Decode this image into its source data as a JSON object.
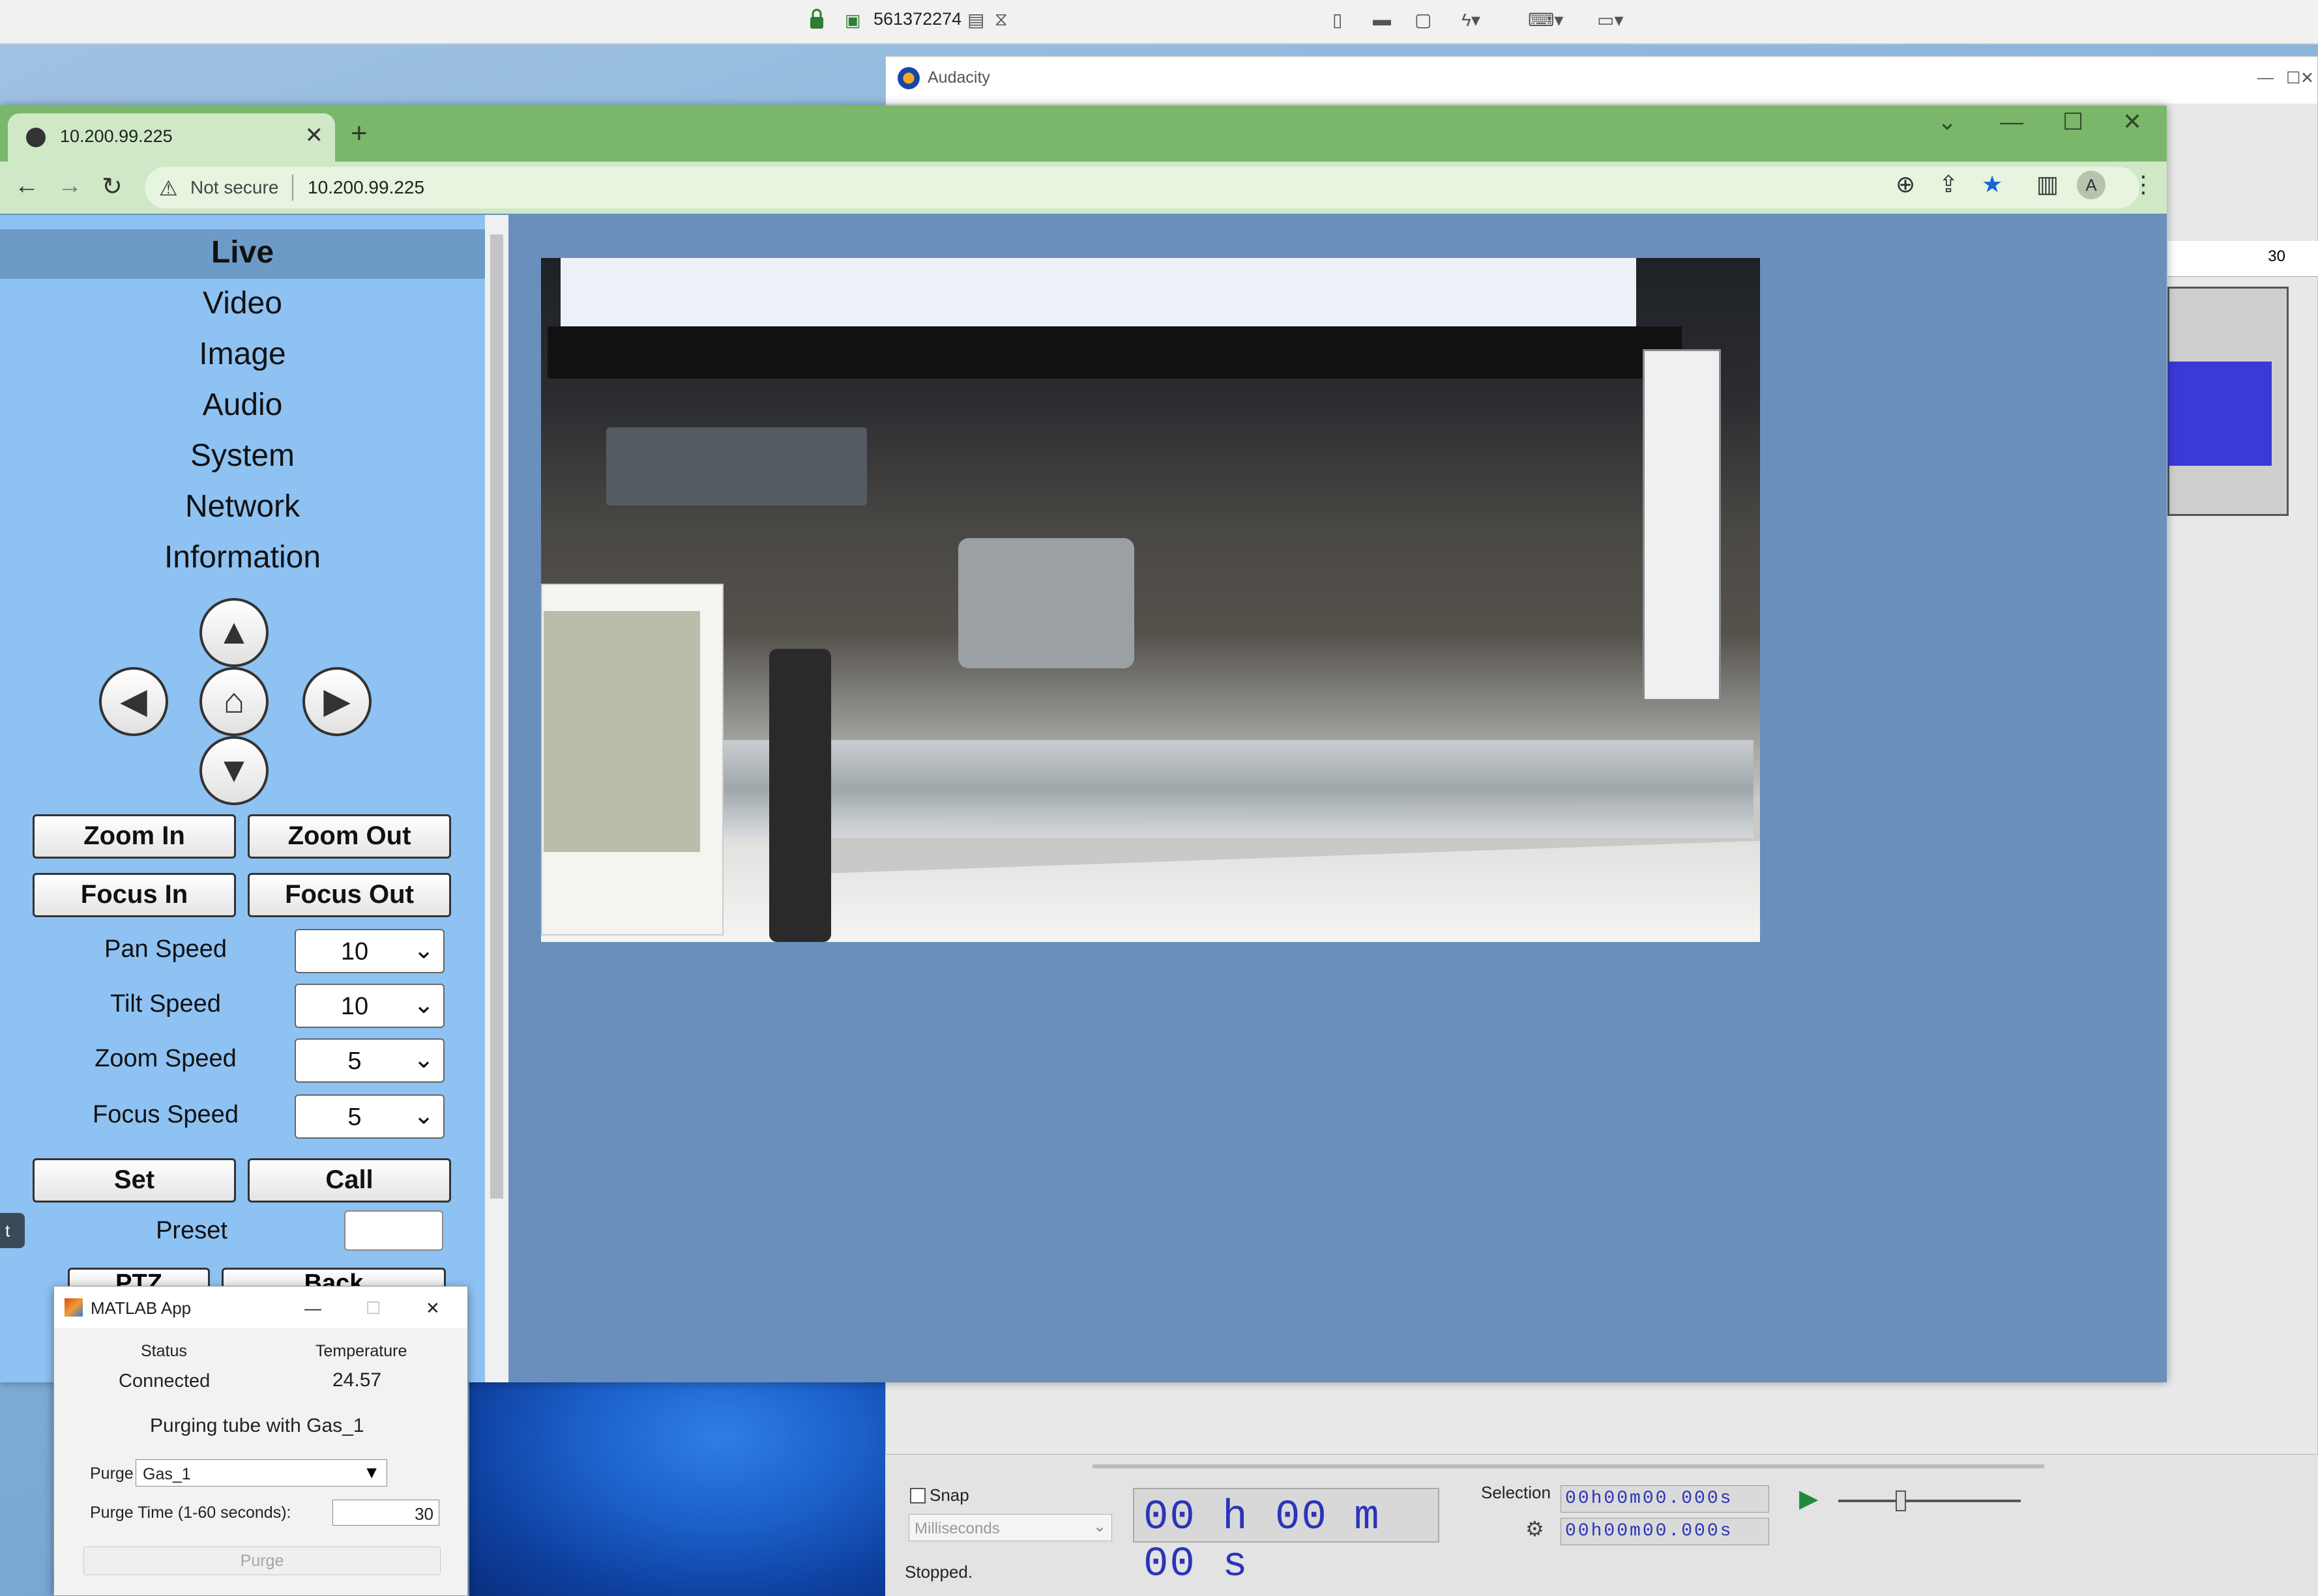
{
  "remote_bar": {
    "session_id": "561372274"
  },
  "audacity": {
    "title": "Audacity",
    "ruler_tick": "30",
    "snap_label": "Snap",
    "time_format": "Milliseconds",
    "big_time": "00 h 00 m 00 s",
    "selection_label": "Selection",
    "selection_start": "00h00m00.000s",
    "selection_end": "00h00m00.000s",
    "status": "Stopped."
  },
  "browser": {
    "tab_title": "10.200.99.225",
    "security_label": "Not secure",
    "url": "10.200.99.225",
    "profile_initial": "A"
  },
  "camera": {
    "menu": [
      "Live",
      "Video",
      "Image",
      "Audio",
      "System",
      "Network",
      "Information"
    ],
    "active_menu": "Live",
    "zoom_in": "Zoom In",
    "zoom_out": "Zoom Out",
    "focus_in": "Focus In",
    "focus_out": "Focus Out",
    "speeds": [
      {
        "label": "Pan Speed",
        "value": "10"
      },
      {
        "label": "Tilt Speed",
        "value": "10"
      },
      {
        "label": "Zoom Speed",
        "value": "5"
      },
      {
        "label": "Focus Speed",
        "value": "5"
      }
    ],
    "set_label": "Set",
    "call_label": "Call",
    "preset_label": "Preset",
    "ptz_label": "PTZ",
    "back_label": "Back",
    "side_tab": "t"
  },
  "matlab": {
    "title": "MATLAB App",
    "status_label": "Status",
    "status_value": "Connected",
    "temp_label": "Temperature",
    "temp_value": "24.57",
    "message": "Purging tube with Gas_1",
    "purge_gas_label": "Purge Gas",
    "purge_gas_value": "Gas_1",
    "purge_time_label": "Purge Time (1-60 seconds):",
    "purge_time_value": "30",
    "purge_button": "Purge"
  }
}
